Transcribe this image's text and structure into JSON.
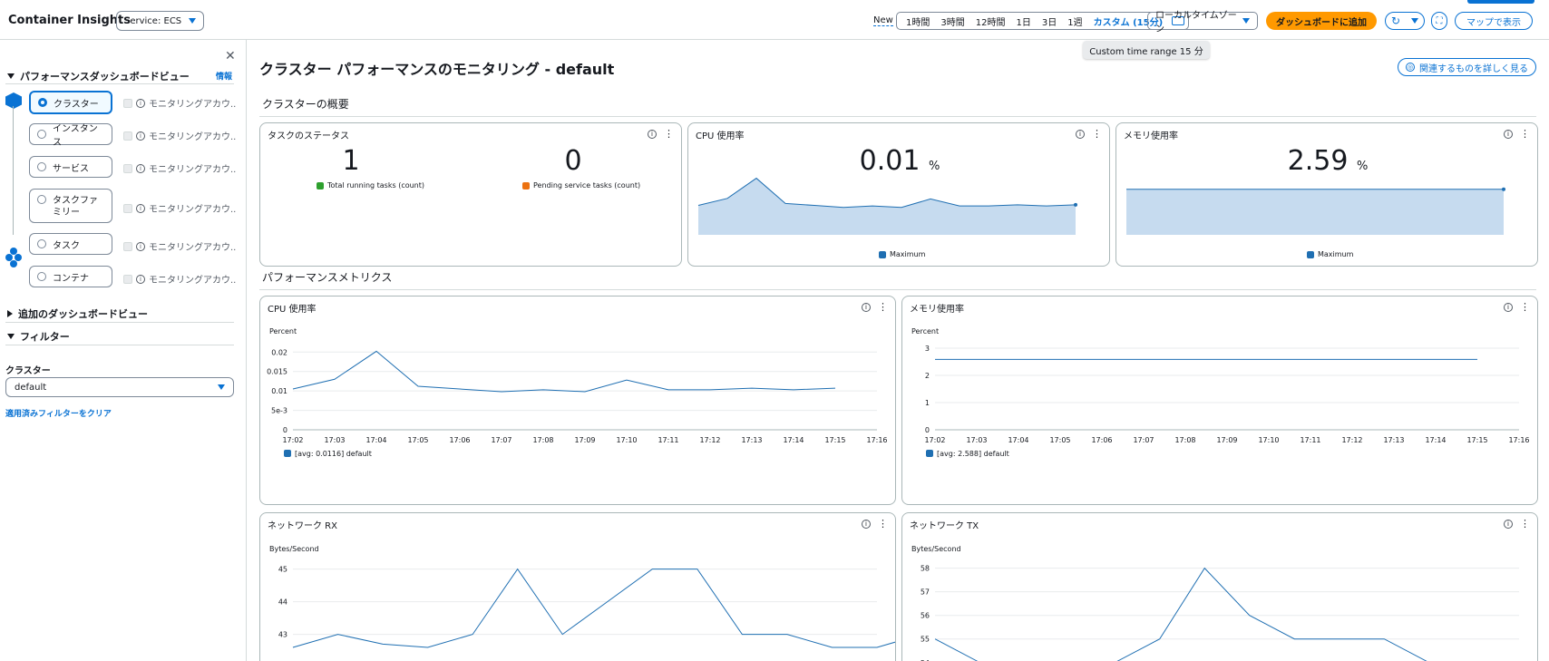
{
  "header": {
    "title": "Container Insights",
    "service_select": "Service: ECS",
    "new_label": "New",
    "time_ranges": [
      "1時間",
      "3時間",
      "12時間",
      "1日",
      "3日",
      "1週"
    ],
    "custom_range": "カスタム (15分)",
    "timezone": "ローカルタイムゾーン",
    "add_dashboard": "ダッシュボードに追加",
    "map_view": "マップで表示",
    "tooltip": "Custom time range 15 分"
  },
  "sidebar": {
    "section_dashboards": "パフォーマンスダッシュボードビュー",
    "info": "情報",
    "items": [
      {
        "label": "クラスター",
        "monitor": "モニタリングアカウ..."
      },
      {
        "label": "インスタンス",
        "monitor": "モニタリングアカウ..."
      },
      {
        "label": "サービス",
        "monitor": "モニタリングアカウ..."
      },
      {
        "label": "タスクファミリー",
        "monitor": "モニタリングアカウ..."
      },
      {
        "label": "タスク",
        "monitor": "モニタリングアカウ..."
      },
      {
        "label": "コンテナ",
        "monitor": "モニタリングアカウ..."
      }
    ],
    "section_additional": "追加のダッシュボードビュー",
    "section_filter": "フィルター",
    "filter_label": "クラスター",
    "filter_value": "default",
    "clear_filters": "適用済みフィルターをクリア"
  },
  "main": {
    "title": "クラスター パフォーマンスのモニタリング - default",
    "explore_button": "関連するものを詳しく見る",
    "overview_title": "クラスターの概要",
    "metrics_title": "パフォーマンスメトリクス",
    "task_status": {
      "title": "タスクのステータス",
      "running": "1",
      "running_label": "Total running tasks (count)",
      "pending": "0",
      "pending_label": "Pending service tasks (count)"
    },
    "cpu_summary": {
      "title": "CPU 使用率",
      "value": "0.01",
      "unit": "%",
      "legend": "Maximum"
    },
    "mem_summary": {
      "title": "メモリ使用率",
      "value": "2.59",
      "unit": "%",
      "legend": "Maximum"
    }
  },
  "colors": {
    "accent": "#0972d3",
    "orange": "#ff9900",
    "line": "#1f6fb2",
    "area": "#c6dbef",
    "green": "#2ea02e",
    "pending": "#ec7211"
  },
  "chart_data": [
    {
      "type": "area",
      "title": "CPU 使用率",
      "series": [
        {
          "name": "Maximum",
          "values": [
            0.0105,
            0.013,
            0.0202,
            0.0112,
            0.0105,
            0.0098,
            0.0103,
            0.0098,
            0.0128,
            0.0103,
            0.0103,
            0.0107,
            0.0103,
            0.0107
          ]
        }
      ],
      "ylim": [
        0,
        0.022
      ]
    },
    {
      "type": "area",
      "title": "メモリ使用率",
      "series": [
        {
          "name": "Maximum",
          "values": [
            2.588,
            2.588
          ]
        }
      ],
      "ylim": [
        0,
        3.5
      ]
    },
    {
      "type": "line",
      "title": "CPU 使用率",
      "ylabel": "Percent",
      "categories": [
        "17:02",
        "17:03",
        "17:04",
        "17:05",
        "17:06",
        "17:07",
        "17:08",
        "17:09",
        "17:10",
        "17:11",
        "17:12",
        "17:13",
        "17:14",
        "17:15",
        "17:16"
      ],
      "series": [
        {
          "name": "[avg: 0.0116] default",
          "values": [
            0.0105,
            0.013,
            0.0202,
            0.0112,
            0.0105,
            0.0098,
            0.0103,
            0.0098,
            0.0128,
            0.0103,
            0.0103,
            0.0107,
            0.0103,
            0.0107
          ]
        }
      ],
      "yticks": [
        "0",
        "5e-3",
        "0.01",
        "0.015",
        "0.02"
      ],
      "ylim": [
        0,
        0.021
      ]
    },
    {
      "type": "line",
      "title": "メモリ使用率",
      "ylabel": "Percent",
      "categories": [
        "17:02",
        "17:03",
        "17:04",
        "17:05",
        "17:06",
        "17:07",
        "17:08",
        "17:09",
        "17:10",
        "17:11",
        "17:12",
        "17:13",
        "17:14",
        "17:15",
        "17:16"
      ],
      "series": [
        {
          "name": "[avg: 2.588] default",
          "values": [
            2.588,
            2.588,
            2.588,
            2.588,
            2.588,
            2.588,
            2.588,
            2.588,
            2.588,
            2.588,
            2.588,
            2.588,
            2.588,
            2.588
          ]
        }
      ],
      "yticks": [
        "0",
        "1",
        "2",
        "3"
      ],
      "ylim": [
        0,
        3
      ]
    },
    {
      "type": "line",
      "title": "ネットワーク RX",
      "ylabel": "Bytes/Second",
      "series": [
        {
          "name": "",
          "values": [
            42.6,
            43,
            42.7,
            42.6,
            43,
            45,
            43,
            44,
            45,
            45,
            43,
            43,
            42.6,
            42.6,
            43
          ]
        }
      ],
      "yticks": [
        "43",
        "44",
        "45"
      ],
      "ylim": [
        42.6,
        45.1
      ]
    },
    {
      "type": "line",
      "title": "ネットワーク TX",
      "ylabel": "Bytes/Second",
      "series": [
        {
          "name": "",
          "values": [
            55,
            54,
            54,
            54,
            54,
            55,
            58,
            56,
            55,
            55,
            55,
            54,
            53.8,
            54
          ]
        }
      ],
      "yticks": [
        "54",
        "55",
        "56",
        "57",
        "58"
      ],
      "ylim": [
        53.8,
        58.1
      ]
    }
  ]
}
